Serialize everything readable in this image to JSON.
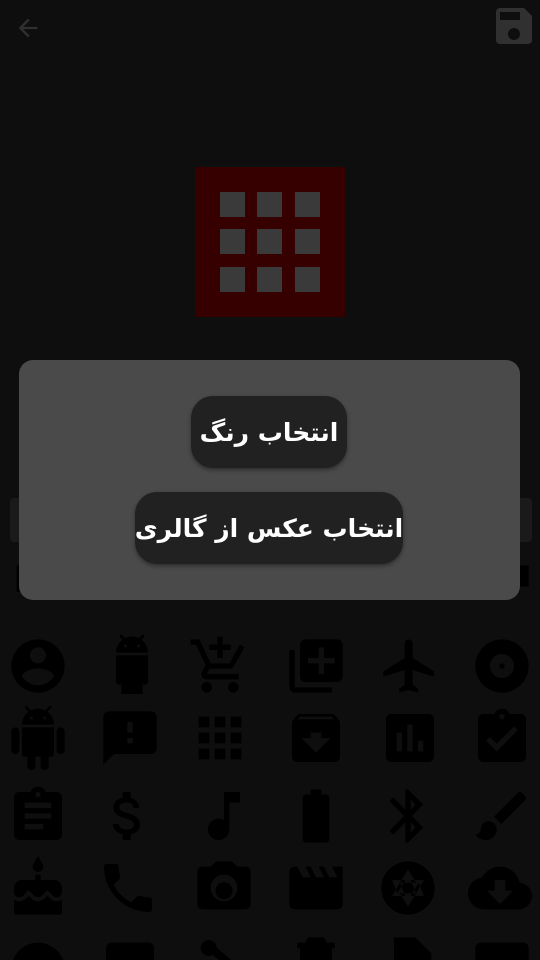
{
  "toolbar": {
    "back_icon": "arrow-back-icon",
    "save_icon": "floppy-save-icon"
  },
  "preview": {
    "icon": "apps-grid-icon",
    "background_color": "#7a0000",
    "icon_color": "#808080"
  },
  "icon_grid": {
    "icons": [
      "account-circle-icon",
      "android-robot-icon",
      "add-shopping-cart-icon",
      "add-to-queue-icon",
      "airplane-icon",
      "album-icon",
      "android-icon",
      "feedback-icon",
      "apps-icon",
      "archive-icon",
      "assessment-icon",
      "assignment-turned-in-icon",
      "assignment-icon",
      "dollar-icon",
      "music-note-icon",
      "battery-icon",
      "bluetooth-icon",
      "brush-icon",
      "cake-icon",
      "phone-icon",
      "camera-icon",
      "movie-icon",
      "camera-shutter-icon",
      "cloud-download-icon"
    ]
  },
  "dialog": {
    "choose_color_label": "انتخاب رنگ",
    "choose_gallery_label": "انتخاب عکس از گالری"
  }
}
